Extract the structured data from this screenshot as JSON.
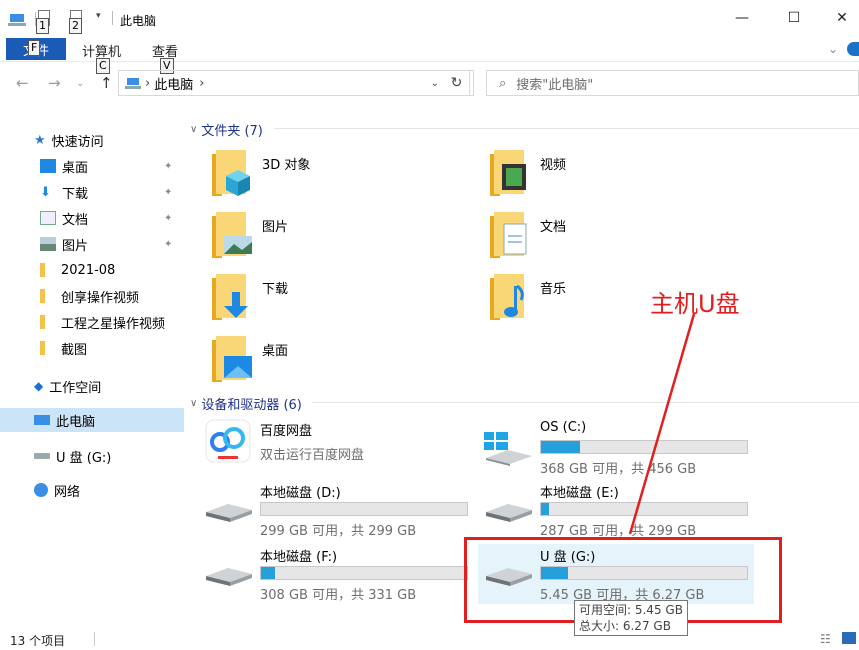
{
  "window": {
    "title": "此电脑",
    "minimize": "—",
    "maximize": "☐",
    "close": "✕",
    "keytips": {
      "qa1": "1",
      "qa2": "2",
      "file": "F",
      "computer": "C",
      "view": "V"
    }
  },
  "ribbon": {
    "file": "文件",
    "tabs": [
      "计算机",
      "查看"
    ]
  },
  "address": {
    "path": "此电脑",
    "search_placeholder": "搜索\"此电脑\""
  },
  "sidebar": {
    "items": [
      {
        "label": "快速访问",
        "icon": "star-icon"
      },
      {
        "label": "桌面",
        "icon": "desktop-icon",
        "pinned": true
      },
      {
        "label": "下载",
        "icon": "download-icon",
        "pinned": true
      },
      {
        "label": "文档",
        "icon": "document-icon",
        "pinned": true
      },
      {
        "label": "图片",
        "icon": "picture-icon",
        "pinned": true
      },
      {
        "label": "2021-08",
        "icon": "folder-icon"
      },
      {
        "label": "创享操作视频",
        "icon": "folder-icon"
      },
      {
        "label": "工程之星操作视频",
        "icon": "folder-icon"
      },
      {
        "label": "截图",
        "icon": "folder-icon"
      },
      {
        "label": "工作空间",
        "icon": "workspace-icon"
      },
      {
        "label": "此电脑",
        "icon": "computer-icon",
        "selected": true
      },
      {
        "label": "U 盘 (G:)",
        "icon": "usb-drive-icon"
      },
      {
        "label": "网络",
        "icon": "network-icon"
      }
    ]
  },
  "folders_section": {
    "header": "文件夹 (7)",
    "items": [
      {
        "label": "3D 对象",
        "icon": "3d-objects-folder-icon"
      },
      {
        "label": "视频",
        "icon": "video-folder-icon"
      },
      {
        "label": "图片",
        "icon": "pictures-folder-icon"
      },
      {
        "label": "文档",
        "icon": "documents-folder-icon"
      },
      {
        "label": "下载",
        "icon": "downloads-folder-icon"
      },
      {
        "label": "音乐",
        "icon": "music-folder-icon"
      },
      {
        "label": "桌面",
        "icon": "desktop-folder-icon"
      }
    ]
  },
  "drives_section": {
    "header": "设备和驱动器 (6)",
    "items": [
      {
        "name": "百度网盘",
        "info": "双击运行百度网盘",
        "icon": "baidu-netdisk-icon"
      },
      {
        "name": "OS (C:)",
        "info": "368 GB 可用，共 456 GB",
        "used_fraction": 0.19,
        "icon": "windows-drive-icon"
      },
      {
        "name": "本地磁盘 (D:)",
        "info": "299 GB 可用，共 299 GB",
        "used_fraction": 0.0,
        "icon": "hard-drive-icon"
      },
      {
        "name": "本地磁盘 (E:)",
        "info": "287 GB 可用，共 299 GB",
        "used_fraction": 0.04,
        "icon": "hard-drive-icon"
      },
      {
        "name": "本地磁盘 (F:)",
        "info": "308 GB 可用，共 331 GB",
        "used_fraction": 0.07,
        "icon": "hard-drive-icon"
      },
      {
        "name": "U 盘 (G:)",
        "info": "5.45 GB 可用，共 6.27 GB",
        "used_fraction": 0.13,
        "icon": "usb-drive-icon",
        "selected": true
      }
    ]
  },
  "tooltip": {
    "line1": "可用空间: 5.45 GB",
    "line2": "总大小: 6.27 GB"
  },
  "annotation": {
    "label": "主机U盘",
    "color": "#e02020"
  },
  "status": {
    "count": "13 个项目"
  },
  "colors": {
    "accent": "#1a5bb5",
    "selection": "#cce4f7",
    "drive_fill": "#26a0da",
    "section_header": "#1e3287"
  }
}
